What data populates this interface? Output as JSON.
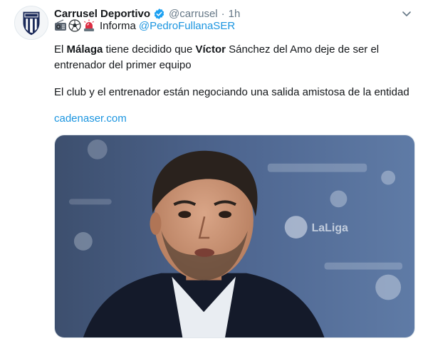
{
  "tweet": {
    "author_name": "Carrusel Deportivo",
    "handle": "@carrusel",
    "separator": "·",
    "time": "1h",
    "informa_label": "Informa",
    "mention": "@PedroFullanaSER",
    "emojis": [
      "radio-icon",
      "soccer-ball-icon",
      "siren-icon"
    ],
    "paragraph1": {
      "part1": "El ",
      "bold1": "Málaga",
      "part2": " tiene decidido que ",
      "bold2": "Víctor",
      "part3": " Sánchez del Amo deje de ser el entrenador del primer equipo"
    },
    "paragraph2": "El club y el entrenador están negociando una salida amistosa de la entidad",
    "link": "cadenaser.com",
    "verified_color": "#1da1f2",
    "link_color": "#1b95e0",
    "photo_logo_text": "LaLiga"
  }
}
